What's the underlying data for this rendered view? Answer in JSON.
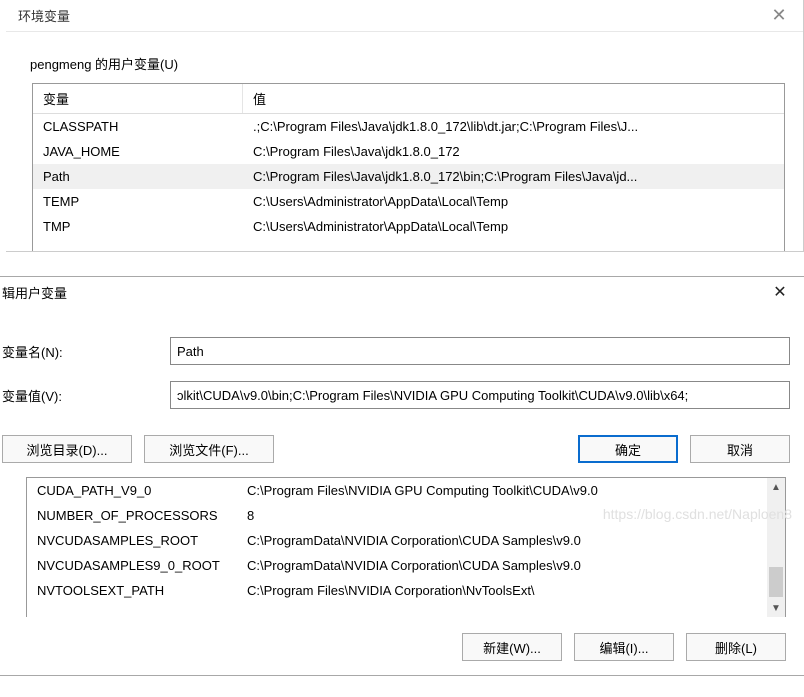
{
  "dialog1": {
    "title": "环境变量",
    "group_label": "pengmeng 的用户变量(U)",
    "columns": {
      "var": "变量",
      "val": "值"
    },
    "rows": [
      {
        "var": "CLASSPATH",
        "val": ".;C:\\Program Files\\Java\\jdk1.8.0_172\\lib\\dt.jar;C:\\Program Files\\J..."
      },
      {
        "var": "JAVA_HOME",
        "val": "C:\\Program Files\\Java\\jdk1.8.0_172"
      },
      {
        "var": "Path",
        "val": "C:\\Program Files\\Java\\jdk1.8.0_172\\bin;C:\\Program Files\\Java\\jd..."
      },
      {
        "var": "TEMP",
        "val": "C:\\Users\\Administrator\\AppData\\Local\\Temp"
      },
      {
        "var": "TMP",
        "val": "C:\\Users\\Administrator\\AppData\\Local\\Temp"
      }
    ],
    "selected_index": 2
  },
  "dialog2": {
    "title": "辑用户变量",
    "name_label": "变量名(N):",
    "value_label": "变量值(V):",
    "name_value": "Path",
    "value_value": "ɔlkit\\CUDA\\v9.0\\bin;C:\\Program Files\\NVIDIA GPU Computing Toolkit\\CUDA\\v9.0\\lib\\x64;",
    "browse_dir": "浏览目录(D)...",
    "browse_file": "浏览文件(F)...",
    "ok": "确定",
    "cancel": "取消"
  },
  "lower": {
    "rows": [
      {
        "var": "CUDA_PATH_V9_0",
        "val": "C:\\Program Files\\NVIDIA GPU Computing Toolkit\\CUDA\\v9.0"
      },
      {
        "var": "NUMBER_OF_PROCESSORS",
        "val": "8"
      },
      {
        "var": "NVCUDASAMPLES_ROOT",
        "val": "C:\\ProgramData\\NVIDIA Corporation\\CUDA Samples\\v9.0"
      },
      {
        "var": "NVCUDASAMPLES9_0_ROOT",
        "val": "C:\\ProgramData\\NVIDIA Corporation\\CUDA Samples\\v9.0"
      },
      {
        "var": "NVTOOLSEXT_PATH",
        "val": "C:\\Program Files\\NVIDIA Corporation\\NvToolsExt\\"
      }
    ],
    "new_btn": "新建(W)...",
    "edit_btn": "编辑(I)...",
    "delete_btn": "删除(L)"
  },
  "watermark": "https://blog.csdn.net/Naploen8"
}
